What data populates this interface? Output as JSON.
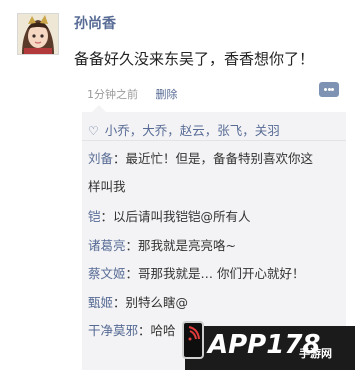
{
  "post": {
    "author": "孙尚香",
    "content": "备备好久没来东吴了，香香想你了！",
    "time": "1分钟之前",
    "delete_label": "删除"
  },
  "likes": {
    "names": "小乔，大乔，赵云，张飞，关羽"
  },
  "comments": [
    {
      "name": "刘备",
      "text": "：最近忙！但是，备备特别喜欢你这"
    },
    {
      "name": "",
      "text": "样叫我"
    },
    {
      "name": "铠",
      "text": "：以后请叫我铠铠@所有人"
    },
    {
      "name": "诸葛亮",
      "text": "：那我就是亮亮咯~"
    },
    {
      "name": "蔡文姬",
      "text": "：哥那我就是…  你们开心就好！"
    },
    {
      "name": "甄姬",
      "text": "：别特么瞎@"
    },
    {
      "name": "干净莫邪",
      "text": "：哈哈"
    }
  ],
  "watermark": {
    "brand": "APP178",
    "sub": "手游网"
  },
  "colors": {
    "link": "#576b95",
    "panel_bg": "#f3f3f5",
    "meta": "#9a9a9a"
  }
}
